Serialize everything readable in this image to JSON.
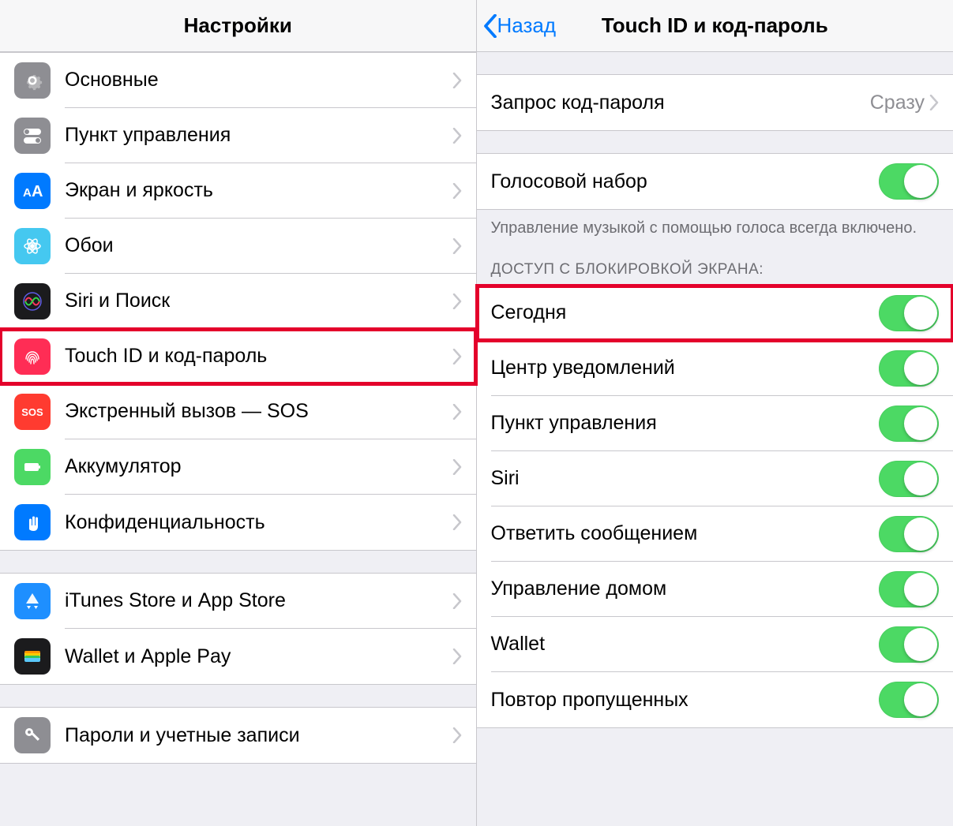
{
  "left": {
    "title": "Настройки",
    "groups": [
      {
        "rows": [
          {
            "id": "general",
            "label": "Основные",
            "icon": "gear-icon",
            "color": "c-general"
          },
          {
            "id": "control",
            "label": "Пункт управления",
            "icon": "toggles-icon",
            "color": "c-control"
          },
          {
            "id": "display",
            "label": "Экран и яркость",
            "icon": "text-size-icon",
            "color": "c-display"
          },
          {
            "id": "wallpaper",
            "label": "Обои",
            "icon": "flower-icon",
            "color": "c-wallpaper"
          },
          {
            "id": "siri",
            "label": "Siri и Поиск",
            "icon": "siri-icon",
            "color": "c-siri"
          },
          {
            "id": "touchid",
            "label": "Touch ID и код-пароль",
            "icon": "fingerprint-icon",
            "color": "c-touchid",
            "highlight": true
          },
          {
            "id": "sos",
            "label": "Экстренный вызов — SOS",
            "icon": "sos-icon",
            "color": "c-sos"
          },
          {
            "id": "battery",
            "label": "Аккумулятор",
            "icon": "battery-icon",
            "color": "c-battery"
          },
          {
            "id": "privacy",
            "label": "Конфиденциальность",
            "icon": "hand-icon",
            "color": "c-privacy"
          }
        ]
      },
      {
        "rows": [
          {
            "id": "itunes",
            "label": "iTunes Store и App Store",
            "icon": "appstore-icon",
            "color": "c-itunes"
          },
          {
            "id": "wallet",
            "label": "Wallet и Apple Pay",
            "icon": "wallet-icon",
            "color": "c-wallet"
          }
        ]
      },
      {
        "rows": [
          {
            "id": "passwords",
            "label": "Пароли и учетные записи",
            "icon": "key-icon",
            "color": "c-passwords"
          }
        ]
      }
    ]
  },
  "right": {
    "back": "Назад",
    "title": "Touch ID и код-пароль",
    "require": {
      "label": "Запрос код-пароля",
      "value": "Сразу"
    },
    "voice": {
      "label": "Голосовой набор",
      "note": "Управление музыкой с помощью голоса всегда включено."
    },
    "lock_header": "ДОСТУП С БЛОКИРОВКОЙ ЭКРАНА:",
    "lock_rows": [
      {
        "id": "today",
        "label": "Сегодня",
        "highlight": true
      },
      {
        "id": "notif",
        "label": "Центр уведомлений"
      },
      {
        "id": "controlc",
        "label": "Пункт управления"
      },
      {
        "id": "siri",
        "label": "Siri"
      },
      {
        "id": "reply",
        "label": "Ответить сообщением"
      },
      {
        "id": "home",
        "label": "Управление домом"
      },
      {
        "id": "walletacc",
        "label": "Wallet"
      },
      {
        "id": "missed",
        "label": "Повтор пропущенных"
      }
    ]
  }
}
